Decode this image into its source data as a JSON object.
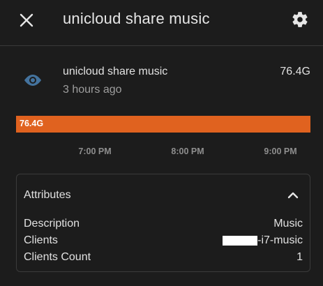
{
  "header": {
    "title": "unicloud share music",
    "close_icon": "close-icon",
    "settings_icon": "gear-icon"
  },
  "entity": {
    "icon": "eye-icon",
    "name": "unicloud share music",
    "last_changed": "3 hours ago",
    "state": "76.4G"
  },
  "timeline": {
    "bar_label": "76.4G",
    "bar_color": "#e0621f",
    "ticks": [
      "7:00 PM",
      "8:00 PM",
      "9:00 PM"
    ]
  },
  "attributes": {
    "title": "Attributes",
    "expanded": true,
    "rows": [
      {
        "key": "Description",
        "value": "Music"
      },
      {
        "key": "Clients",
        "value": "-i7-music",
        "redacted_prefix": true
      },
      {
        "key": "Clients Count",
        "value": "1"
      }
    ]
  },
  "colors": {
    "background": "#1c1c1c",
    "accent_icon": "#44739e",
    "bar": "#e0621f"
  }
}
